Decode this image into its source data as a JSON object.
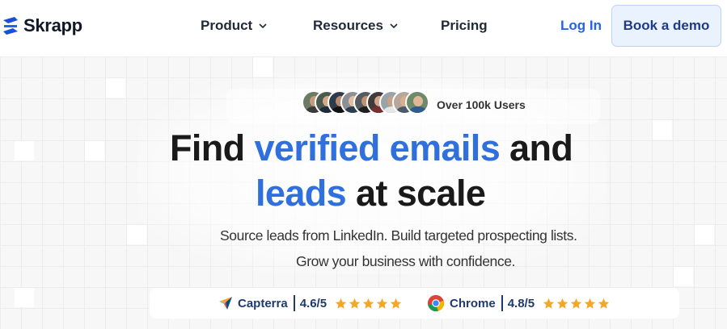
{
  "header": {
    "brand": "Skrapp",
    "nav": {
      "product": "Product",
      "resources": "Resources",
      "pricing": "Pricing"
    },
    "login_label": "Log In",
    "demo_label": "Book a demo"
  },
  "hero": {
    "users_label": "Over 100k Users",
    "headline_line1_start": "Find ",
    "headline_line1_accent": "verified emails",
    "headline_line1_end": " and",
    "headline_line2_accent": "leads",
    "headline_line2_end": " at scale",
    "subtitle_line1": "Source leads from LinkedIn. Build targeted prospecting lists.",
    "subtitle_line2": "Grow your business with confidence."
  },
  "ratings": [
    {
      "name": "Capterra",
      "score": "4.6/5",
      "icon": "capterra-icon",
      "stars": 5
    },
    {
      "name": "Chrome",
      "score": "4.8/5",
      "icon": "chrome-icon",
      "stars": 5
    }
  ],
  "colors": {
    "accent": "#2f6fde",
    "link": "#2563eb",
    "star": "#f5a623",
    "rating_text": "#1f3b6b",
    "demo_bg": "#eaf2fd"
  }
}
